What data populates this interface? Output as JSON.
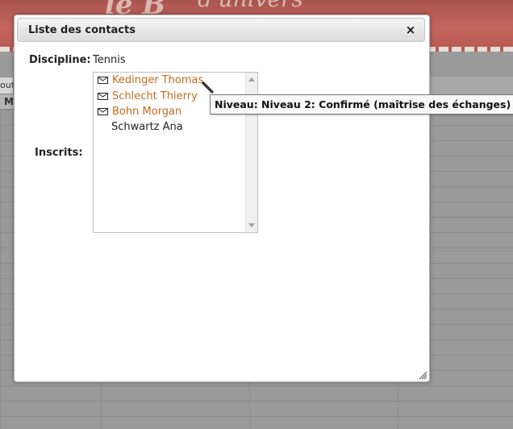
{
  "background": {
    "banner_text_1": "le B",
    "banner_text_2": "d'univers",
    "tab_label": "out",
    "header_col": "M"
  },
  "dialog": {
    "title": "Liste des contacts",
    "close_label": "×",
    "discipline_label": "Discipline:",
    "discipline_value": "Tennis",
    "inscrits_label": "Inscrits:",
    "inscrits": [
      {
        "name": "Kedinger Thomas",
        "has_email": true
      },
      {
        "name": "Schlecht Thierry",
        "has_email": true
      },
      {
        "name": "Bohn Morgan",
        "has_email": true
      },
      {
        "name": "Schwartz Ana",
        "has_email": false
      }
    ]
  },
  "tooltip": {
    "text": "Niveau: Niveau 2: Confirmé (maîtrise des échanges)"
  },
  "colors": {
    "link": "#c56a1b",
    "overlay": "#9a9a9a",
    "banner": "#b65a52"
  }
}
